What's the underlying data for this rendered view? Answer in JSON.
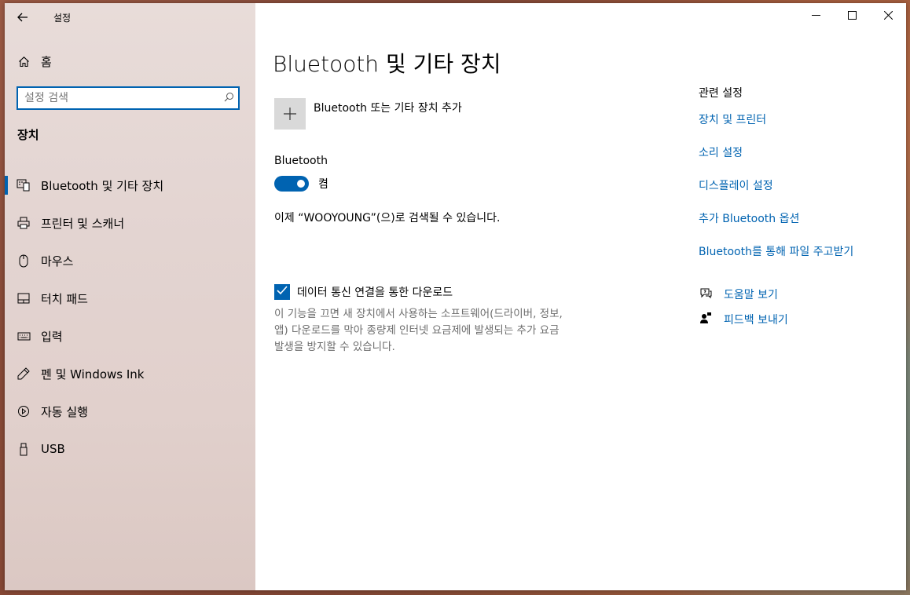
{
  "titlebar": {
    "app_title": "설정"
  },
  "sidebar": {
    "home_label": "홈",
    "search_placeholder": "설정 검색",
    "section_title": "장치",
    "items": [
      {
        "label": "Bluetooth 및 기타 장치",
        "icon": "bluetooth-devices-icon",
        "selected": true
      },
      {
        "label": "프린터 및 스캐너",
        "icon": "printer-icon",
        "selected": false
      },
      {
        "label": "마우스",
        "icon": "mouse-icon",
        "selected": false
      },
      {
        "label": "터치 패드",
        "icon": "touchpad-icon",
        "selected": false
      },
      {
        "label": "입력",
        "icon": "keyboard-icon",
        "selected": false
      },
      {
        "label": "펜 및 Windows Ink",
        "icon": "pen-icon",
        "selected": false
      },
      {
        "label": "자동 실행",
        "icon": "autoplay-icon",
        "selected": false
      },
      {
        "label": "USB",
        "icon": "usb-icon",
        "selected": false
      }
    ]
  },
  "main": {
    "title": "Bluetooth 및 기타 장치",
    "add_device_label": "Bluetooth 또는 기타 장치 추가",
    "bluetooth_label": "Bluetooth",
    "toggle_state": "켬",
    "discoverable_text": "이제 “WOOYOUNG”(으)로 검색될 수 있습니다.",
    "metered_label": "데이터 통신 연결을 통한 다운로드",
    "metered_checked": true,
    "metered_desc_lines": [
      "이 기능을 끄면 새 장치에서 사용하는 소프트웨어(드라이버, 정보,",
      "앱) 다운로드를 막아 종량제 인터넷 요금제에 발생되는 추가 요금",
      "발생을 방지할 수 있습니다."
    ]
  },
  "related": {
    "title": "관련 설정",
    "links": [
      "장치 및 프린터",
      "소리 설정",
      "디스플레이 설정",
      "추가 Bluetooth 옵션",
      "Bluetooth를 통해 파일 주고받기"
    ]
  },
  "help": {
    "get_help": "도움말 보기",
    "feedback": "피드백 보내기"
  },
  "colors": {
    "accent": "#0063b1",
    "desc_text": "#6d6d6d"
  }
}
